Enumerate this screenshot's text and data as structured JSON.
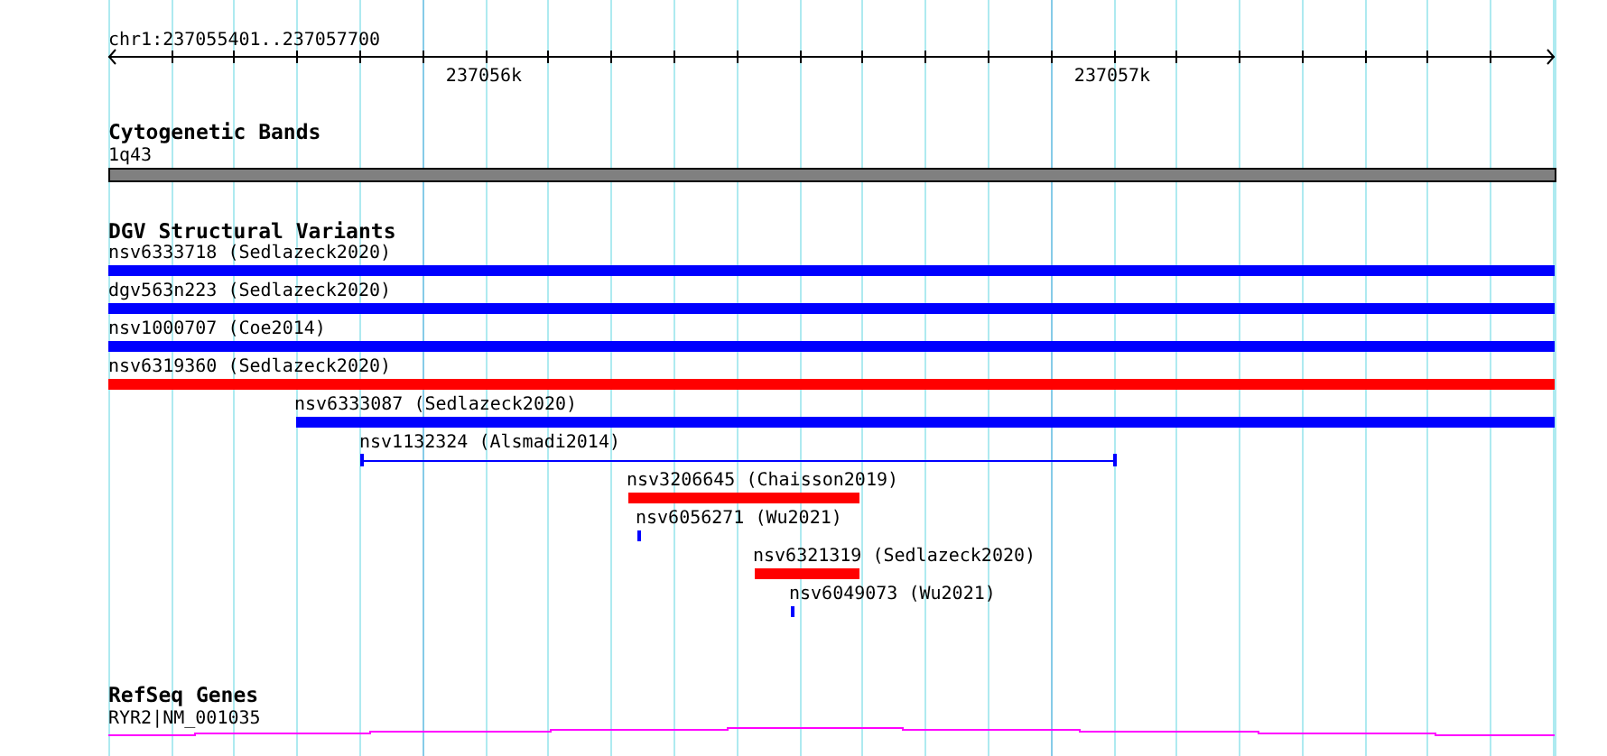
{
  "ruler": {
    "location": "chr1:237055401..237057700",
    "ticks": [
      "237056k",
      "237057k"
    ]
  },
  "tracks": [
    {
      "kind": "bands",
      "title": "Cytogenetic Bands",
      "features": [
        {
          "label": "1q43"
        }
      ]
    },
    {
      "kind": "variants",
      "title": "DGV Structural Variants",
      "features": [
        {
          "label": "nsv6333718 (Sedlazeck2020)",
          "color": "#0000ff",
          "kind": "bar"
        },
        {
          "label": "dgv563n223 (Sedlazeck2020)",
          "color": "#0000ff",
          "kind": "bar"
        },
        {
          "label": "nsv1000707 (Coe2014)",
          "color": "#0000ff",
          "kind": "bar"
        },
        {
          "label": "nsv6319360 (Sedlazeck2020)",
          "color": "#ff0000",
          "kind": "bar"
        },
        {
          "label": "nsv6333087 (Sedlazeck2020)",
          "color": "#0000ff",
          "kind": "bar"
        },
        {
          "label": "nsv1132324 (Alsmadi2014)",
          "color": "#0000ff",
          "kind": "span"
        },
        {
          "label": "nsv3206645 (Chaisson2019)",
          "color": "#ff0000",
          "kind": "bar"
        },
        {
          "label": "nsv6056271 (Wu2021)",
          "color": "#0000ff",
          "kind": "bar"
        },
        {
          "label": "nsv6321319 (Sedlazeck2020)",
          "color": "#ff0000",
          "kind": "bar"
        },
        {
          "label": "nsv6049073 (Wu2021)",
          "color": "#0000ff",
          "kind": "bar"
        }
      ]
    },
    {
      "kind": "genes",
      "title": "RefSeq Genes",
      "features": [
        {
          "label": "RYR2|NM_001035"
        }
      ]
    }
  ]
}
